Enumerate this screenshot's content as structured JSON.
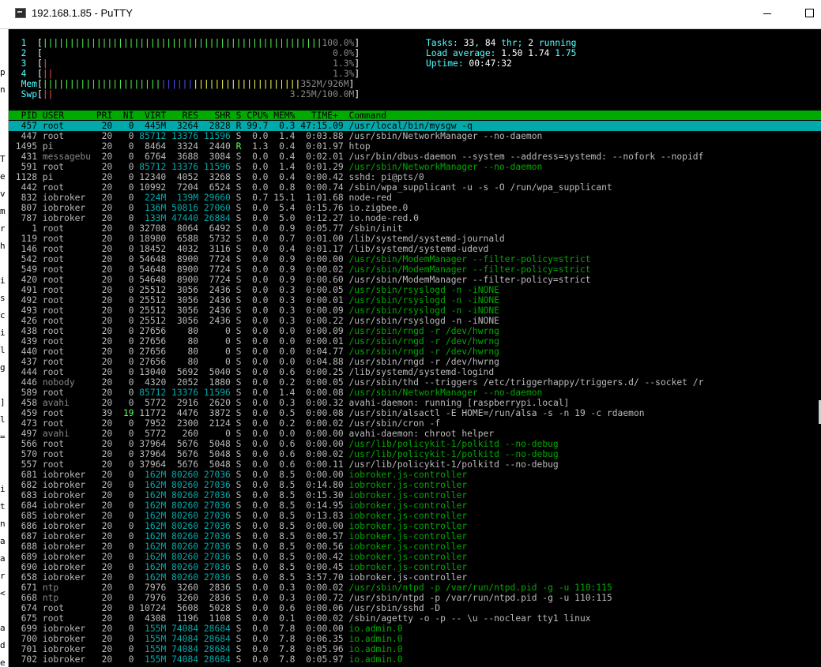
{
  "window": {
    "title": "192.168.1.85 - PuTTY"
  },
  "colors": {
    "bg": "#000000",
    "default": "#bbbbbb",
    "green": "#55ff55",
    "dkgreen": "#00aa00",
    "cyan": "#55ffff",
    "dkcyan": "#00aaaa",
    "red": "#ff5555",
    "dkred": "#aa0000",
    "blue": "#5555ff",
    "yellow": "#ffff55",
    "white": "#ffffff",
    "gray": "#888888",
    "black": "#000000",
    "header_bg": "#00aa00",
    "selected_bg": "#00aaaa"
  },
  "left_strip": [
    "p",
    "n",
    "",
    "",
    "",
    "T",
    "e",
    "v",
    "m",
    "r",
    "h",
    "",
    "i",
    "s",
    "c",
    "i",
    "l",
    "g",
    "",
    "]",
    "l",
    "=",
    "",
    "",
    "i",
    "t",
    "n",
    "a",
    "a",
    "r",
    "<",
    "",
    "a",
    "d",
    "e"
  ],
  "terminal": {
    "meters": [
      [
        {
          "t": "  1  ",
          "c": "cyan"
        },
        {
          "t": "[",
          "c": "white"
        },
        {
          "t": "||||||||||||||||||||||||||||||||||||||||||||||||||||",
          "c": "green"
        },
        {
          "t": "100.0%",
          "c": "gray"
        },
        {
          "t": "]",
          "c": "white"
        }
      ],
      [
        {
          "t": "  2  ",
          "c": "cyan"
        },
        {
          "t": "[",
          "c": "white"
        },
        {
          "t": "                                                    ",
          "c": "green"
        },
        {
          "t": "  0.0%",
          "c": "gray"
        },
        {
          "t": "]",
          "c": "white"
        }
      ],
      [
        {
          "t": "  3  ",
          "c": "cyan"
        },
        {
          "t": "[",
          "c": "white"
        },
        {
          "t": "|",
          "c": "red"
        },
        {
          "t": "                                                   ",
          "c": "green"
        },
        {
          "t": "  1.3%",
          "c": "gray"
        },
        {
          "t": "]",
          "c": "white"
        }
      ],
      [
        {
          "t": "  4  ",
          "c": "cyan"
        },
        {
          "t": "[",
          "c": "white"
        },
        {
          "t": "||",
          "c": "red"
        },
        {
          "t": "                                                  ",
          "c": "green"
        },
        {
          "t": "  1.3%",
          "c": "gray"
        },
        {
          "t": "]",
          "c": "white"
        }
      ],
      [
        {
          "t": "  Mem",
          "c": "cyan"
        },
        {
          "t": "[",
          "c": "white"
        },
        {
          "t": "||||||||||||||||||||||",
          "c": "green"
        },
        {
          "t": "||||||",
          "c": "blue"
        },
        {
          "t": "||||||||||||||||||||",
          "c": "yellow"
        },
        {
          "t": "352M/926M",
          "c": "gray"
        },
        {
          "t": "]",
          "c": "white"
        }
      ],
      [
        {
          "t": "  Swp",
          "c": "cyan"
        },
        {
          "t": "[",
          "c": "white"
        },
        {
          "t": "||",
          "c": "red"
        },
        {
          "t": "                                            ",
          "c": "green"
        },
        {
          "t": "3.25M/100.0M",
          "c": "gray"
        },
        {
          "t": "]",
          "c": "white"
        }
      ]
    ],
    "stats": [
      [
        {
          "t": "Tasks: ",
          "c": "cyan"
        },
        {
          "t": "33",
          "c": "white"
        },
        {
          "t": ", ",
          "c": "cyan"
        },
        {
          "t": "84",
          "c": "white"
        },
        {
          "t": " thr; ",
          "c": "cyan"
        },
        {
          "t": "2",
          "c": "white"
        },
        {
          "t": " running",
          "c": "cyan"
        }
      ],
      [
        {
          "t": "Load average: ",
          "c": "cyan"
        },
        {
          "t": "1.50",
          "c": "white"
        },
        {
          "t": " ",
          "c": "cyan"
        },
        {
          "t": "1.74",
          "c": "white"
        },
        {
          "t": " 1.75",
          "c": "cyan"
        }
      ],
      [
        {
          "t": "Uptime: ",
          "c": "cyan"
        },
        {
          "t": "00:47:32",
          "c": "white"
        }
      ]
    ],
    "header": "  PID USER      PRI  NI  VIRT   RES   SHR S CPU% MEM%   TIME+  Command",
    "rows": [
      [
        {
          "t": "  457 root       20   0  445M  3264  2828 R 99.7  0.3 47:15.09 /usr/local/bin/mysgw -q",
          "c": "black"
        }
      ],
      [
        {
          "t": "  447 root       20   0 ",
          "c": "default"
        },
        {
          "t": "85712 13376 11596",
          "c": "dkcyan"
        },
        {
          "t": " S  0.0  1.4  0:03.88 /usr/sbin/NetworkManager --no-daemon",
          "c": "default"
        }
      ],
      [
        {
          "t": " 1495 pi         20   0  8464  3324  2440 ",
          "c": "default"
        },
        {
          "t": "R",
          "c": "green"
        },
        {
          "t": "  1.3  0.4  0:01.97 htop",
          "c": "default"
        }
      ],
      [
        {
          "t": "  431 ",
          "c": "default"
        },
        {
          "t": "messagebu",
          "c": "gray"
        },
        {
          "t": "  20   0  6764  3688  3084 S  0.0  0.4  0:02.01 /usr/bin/dbus-daemon --system --address=systemd: --nofork --nopidf",
          "c": "default"
        }
      ],
      [
        {
          "t": "  591 root       20   0 ",
          "c": "default"
        },
        {
          "t": "85712 13376 11596",
          "c": "dkcyan"
        },
        {
          "t": " S  0.0  1.4  0:01.29 ",
          "c": "default"
        },
        {
          "t": "/usr/sbin/NetworkManager --no-daemon",
          "c": "dkgreen"
        }
      ],
      [
        {
          "t": " 1128 pi         20   0 12340  4052  3268 S  0.0  0.4  0:00.42 sshd: pi@pts/0",
          "c": "default"
        }
      ],
      [
        {
          "t": "  442 root       20   0 10992  7204  6524 S  0.0  0.8  0:00.74 /sbin/wpa_supplicant -u -s -O /run/wpa_supplicant",
          "c": "default"
        }
      ],
      [
        {
          "t": "  832 iobroker   20   0 ",
          "c": "default"
        },
        {
          "t": " 224M  139M 29660",
          "c": "dkcyan"
        },
        {
          "t": " S  0.7 15.1  1:01.68 node-red",
          "c": "default"
        }
      ],
      [
        {
          "t": "  807 iobroker   20   0 ",
          "c": "default"
        },
        {
          "t": " 136M 50816 27060",
          "c": "dkcyan"
        },
        {
          "t": " S  0.0  5.4  0:15.76 io.zigbee.0",
          "c": "default"
        }
      ],
      [
        {
          "t": "  787 iobroker   20   0 ",
          "c": "default"
        },
        {
          "t": " 133M 47440 26884",
          "c": "dkcyan"
        },
        {
          "t": " S  0.0  5.0  0:12.27 io.node-red.0",
          "c": "default"
        }
      ],
      [
        {
          "t": "    1 root       20   0 32708  8064  6492 S  0.0  0.9  0:05.77 /sbin/init",
          "c": "default"
        }
      ],
      [
        {
          "t": "  119 root       20   0 18980  6588  5732 S  0.0  0.7  0:01.00 /lib/systemd/systemd-journald",
          "c": "default"
        }
      ],
      [
        {
          "t": "  146 root       20   0 18452  4032  3116 S  0.0  0.4  0:01.17 /lib/systemd/systemd-udevd",
          "c": "default"
        }
      ],
      [
        {
          "t": "  542 root       20   0 54648  8900  7724 S  0.0  0.9  0:00.00 ",
          "c": "default"
        },
        {
          "t": "/usr/sbin/ModemManager --filter-policy=strict",
          "c": "dkgreen"
        }
      ],
      [
        {
          "t": "  549 root       20   0 54648  8900  7724 S  0.0  0.9  0:00.02 ",
          "c": "default"
        },
        {
          "t": "/usr/sbin/ModemManager --filter-policy=strict",
          "c": "dkgreen"
        }
      ],
      [
        {
          "t": "  420 root       20   0 54648  8900  7724 S  0.0  0.9  0:00.60 /usr/sbin/ModemManager --filter-policy=strict",
          "c": "default"
        }
      ],
      [
        {
          "t": "  491 root       20   0 25512  3056  2436 S  0.0  0.3  0:00.05 ",
          "c": "default"
        },
        {
          "t": "/usr/sbin/rsyslogd -n -iNONE",
          "c": "dkgreen"
        }
      ],
      [
        {
          "t": "  492 root       20   0 25512  3056  2436 S  0.0  0.3  0:00.01 ",
          "c": "default"
        },
        {
          "t": "/usr/sbin/rsyslogd -n -iNONE",
          "c": "dkgreen"
        }
      ],
      [
        {
          "t": "  493 root       20   0 25512  3056  2436 S  0.0  0.3  0:00.09 ",
          "c": "default"
        },
        {
          "t": "/usr/sbin/rsyslogd -n -iNONE",
          "c": "dkgreen"
        }
      ],
      [
        {
          "t": "  426 root       20   0 25512  3056  2436 S  0.0  0.3  0:00.22 /usr/sbin/rsyslogd -n -iNONE",
          "c": "default"
        }
      ],
      [
        {
          "t": "  438 root       20   0 27656    80     0 S  0.0  0.0  0:00.09 ",
          "c": "default"
        },
        {
          "t": "/usr/sbin/rngd -r /dev/hwrng",
          "c": "dkgreen"
        }
      ],
      [
        {
          "t": "  439 root       20   0 27656    80     0 S  0.0  0.0  0:00.01 ",
          "c": "default"
        },
        {
          "t": "/usr/sbin/rngd -r /dev/hwrng",
          "c": "dkgreen"
        }
      ],
      [
        {
          "t": "  440 root       20   0 27656    80     0 S  0.0  0.0  0:04.77 ",
          "c": "default"
        },
        {
          "t": "/usr/sbin/rngd -r /dev/hwrng",
          "c": "dkgreen"
        }
      ],
      [
        {
          "t": "  437 root       20   0 27656    80     0 S  0.0  0.0  0:04.88 /usr/sbin/rngd -r /dev/hwrng",
          "c": "default"
        }
      ],
      [
        {
          "t": "  444 root       20   0 13040  5692  5040 S  0.0  0.6  0:00.25 /lib/systemd/systemd-logind",
          "c": "default"
        }
      ],
      [
        {
          "t": "  446 ",
          "c": "default"
        },
        {
          "t": "nobody",
          "c": "gray"
        },
        {
          "t": "     20   0  4320  2052  1880 S  0.0  0.2  0:00.05 /usr/sbin/thd --triggers /etc/triggerhappy/triggers.d/ --socket /r",
          "c": "default"
        }
      ],
      [
        {
          "t": "  589 root       20   0 ",
          "c": "default"
        },
        {
          "t": "85712 13376 11596",
          "c": "dkcyan"
        },
        {
          "t": " S  0.0  1.4  0:00.08 ",
          "c": "default"
        },
        {
          "t": "/usr/sbin/NetworkManager --no-daemon",
          "c": "dkgreen"
        }
      ],
      [
        {
          "t": "  458 ",
          "c": "default"
        },
        {
          "t": "avahi",
          "c": "gray"
        },
        {
          "t": "      20   0  5772  2916  2620 S  0.0  0.3  0:00.32 avahi-daemon: running [raspberrypi.local]",
          "c": "default"
        }
      ],
      [
        {
          "t": "  459 root       39  ",
          "c": "default"
        },
        {
          "t": "19",
          "c": "green"
        },
        {
          "t": " 11772  4476  3872 S  0.0  0.5  0:00.08 /usr/sbin/alsactl -E HOME=/run/alsa -s -n 19 -c rdaemon",
          "c": "default"
        }
      ],
      [
        {
          "t": "  473 root       20   0  7952  2300  2124 S  0.0  0.2  0:00.02 /usr/sbin/cron -f",
          "c": "default"
        }
      ],
      [
        {
          "t": "  497 ",
          "c": "default"
        },
        {
          "t": "avahi",
          "c": "gray"
        },
        {
          "t": "      20   0  5772   260     0 S  0.0  0.0  0:00.00 avahi-daemon: chroot helper",
          "c": "default"
        }
      ],
      [
        {
          "t": "  566 root       20   0 37964  5676  5048 S  0.0  0.6  0:00.00 ",
          "c": "default"
        },
        {
          "t": "/usr/lib/policykit-1/polkitd --no-debug",
          "c": "dkgreen"
        }
      ],
      [
        {
          "t": "  570 root       20   0 37964  5676  5048 S  0.0  0.6  0:00.02 ",
          "c": "default"
        },
        {
          "t": "/usr/lib/policykit-1/polkitd --no-debug",
          "c": "dkgreen"
        }
      ],
      [
        {
          "t": "  557 root       20   0 37964  5676  5048 S  0.0  0.6  0:00.11 /usr/lib/policykit-1/polkitd --no-debug",
          "c": "default"
        }
      ],
      [
        {
          "t": "  681 iobroker   20   0 ",
          "c": "default"
        },
        {
          "t": " 162M 80260 27036",
          "c": "dkcyan"
        },
        {
          "t": " S  0.0  8.5  0:00.00 ",
          "c": "default"
        },
        {
          "t": "iobroker.js-controller",
          "c": "dkgreen"
        }
      ],
      [
        {
          "t": "  682 iobroker   20   0 ",
          "c": "default"
        },
        {
          "t": " 162M 80260 27036",
          "c": "dkcyan"
        },
        {
          "t": " S  0.0  8.5  0:14.80 ",
          "c": "default"
        },
        {
          "t": "iobroker.js-controller",
          "c": "dkgreen"
        }
      ],
      [
        {
          "t": "  683 iobroker   20   0 ",
          "c": "default"
        },
        {
          "t": " 162M 80260 27036",
          "c": "dkcyan"
        },
        {
          "t": " S  0.0  8.5  0:15.30 ",
          "c": "default"
        },
        {
          "t": "iobroker.js-controller",
          "c": "dkgreen"
        }
      ],
      [
        {
          "t": "  684 iobroker   20   0 ",
          "c": "default"
        },
        {
          "t": " 162M 80260 27036",
          "c": "dkcyan"
        },
        {
          "t": " S  0.0  8.5  0:14.95 ",
          "c": "default"
        },
        {
          "t": "iobroker.js-controller",
          "c": "dkgreen"
        }
      ],
      [
        {
          "t": "  685 iobroker   20   0 ",
          "c": "default"
        },
        {
          "t": " 162M 80260 27036",
          "c": "dkcyan"
        },
        {
          "t": " S  0.0  8.5  0:13.83 ",
          "c": "default"
        },
        {
          "t": "iobroker.js-controller",
          "c": "dkgreen"
        }
      ],
      [
        {
          "t": "  686 iobroker   20   0 ",
          "c": "default"
        },
        {
          "t": " 162M 80260 27036",
          "c": "dkcyan"
        },
        {
          "t": " S  0.0  8.5  0:00.00 ",
          "c": "default"
        },
        {
          "t": "iobroker.js-controller",
          "c": "dkgreen"
        }
      ],
      [
        {
          "t": "  687 iobroker   20   0 ",
          "c": "default"
        },
        {
          "t": " 162M 80260 27036",
          "c": "dkcyan"
        },
        {
          "t": " S  0.0  8.5  0:00.57 ",
          "c": "default"
        },
        {
          "t": "iobroker.js-controller",
          "c": "dkgreen"
        }
      ],
      [
        {
          "t": "  688 iobroker   20   0 ",
          "c": "default"
        },
        {
          "t": " 162M 80260 27036",
          "c": "dkcyan"
        },
        {
          "t": " S  0.0  8.5  0:00.56 ",
          "c": "default"
        },
        {
          "t": "iobroker.js-controller",
          "c": "dkgreen"
        }
      ],
      [
        {
          "t": "  689 iobroker   20   0 ",
          "c": "default"
        },
        {
          "t": " 162M 80260 27036",
          "c": "dkcyan"
        },
        {
          "t": " S  0.0  8.5  0:00.42 ",
          "c": "default"
        },
        {
          "t": "iobroker.js-controller",
          "c": "dkgreen"
        }
      ],
      [
        {
          "t": "  690 iobroker   20   0 ",
          "c": "default"
        },
        {
          "t": " 162M 80260 27036",
          "c": "dkcyan"
        },
        {
          "t": " S  0.0  8.5  0:00.45 ",
          "c": "default"
        },
        {
          "t": "iobroker.js-controller",
          "c": "dkgreen"
        }
      ],
      [
        {
          "t": "  658 iobroker   20   0 ",
          "c": "default"
        },
        {
          "t": " 162M 80260 27036",
          "c": "dkcyan"
        },
        {
          "t": " S  0.0  8.5  3:57.70 iobroker.js-controller",
          "c": "default"
        }
      ],
      [
        {
          "t": "  671 ",
          "c": "default"
        },
        {
          "t": "ntp",
          "c": "gray"
        },
        {
          "t": "        20   0  7976  3260  2836 S  0.0  0.3  0:00.02 ",
          "c": "default"
        },
        {
          "t": "/usr/sbin/ntpd -p /var/run/ntpd.pid -g -u 110:115",
          "c": "dkgreen"
        }
      ],
      [
        {
          "t": "  668 ",
          "c": "default"
        },
        {
          "t": "ntp",
          "c": "gray"
        },
        {
          "t": "        20   0  7976  3260  2836 S  0.0  0.3  0:00.72 /usr/sbin/ntpd -p /var/run/ntpd.pid -g -u 110:115",
          "c": "default"
        }
      ],
      [
        {
          "t": "  674 root       20   0 10724  5608  5028 S  0.0  0.6  0:00.06 /usr/sbin/sshd -D",
          "c": "default"
        }
      ],
      [
        {
          "t": "  675 root       20   0  4308  1196  1108 S  0.0  0.1  0:00.02 /sbin/agetty -o -p -- \\u --noclear tty1 linux",
          "c": "default"
        }
      ],
      [
        {
          "t": "  699 iobroker   20   0 ",
          "c": "default"
        },
        {
          "t": " 155M 74084 28684",
          "c": "dkcyan"
        },
        {
          "t": " S  0.0  7.8  0:00.00 ",
          "c": "default"
        },
        {
          "t": "io.admin.0",
          "c": "dkgreen"
        }
      ],
      [
        {
          "t": "  700 iobroker   20   0 ",
          "c": "default"
        },
        {
          "t": " 155M 74084 28684",
          "c": "dkcyan"
        },
        {
          "t": " S  0.0  7.8  0:06.35 ",
          "c": "default"
        },
        {
          "t": "io.admin.0",
          "c": "dkgreen"
        }
      ],
      [
        {
          "t": "  701 iobroker   20   0 ",
          "c": "default"
        },
        {
          "t": " 155M 74084 28684",
          "c": "dkcyan"
        },
        {
          "t": " S  0.0  7.8  0:05.96 ",
          "c": "default"
        },
        {
          "t": "io.admin.0",
          "c": "dkgreen"
        }
      ],
      [
        {
          "t": "  702 iobroker   20   0 ",
          "c": "default"
        },
        {
          "t": " 155M 74084 28684",
          "c": "dkcyan"
        },
        {
          "t": " S  0.0  7.8  0:05.97 ",
          "c": "default"
        },
        {
          "t": "io.admin.0",
          "c": "dkgreen"
        }
      ]
    ]
  }
}
